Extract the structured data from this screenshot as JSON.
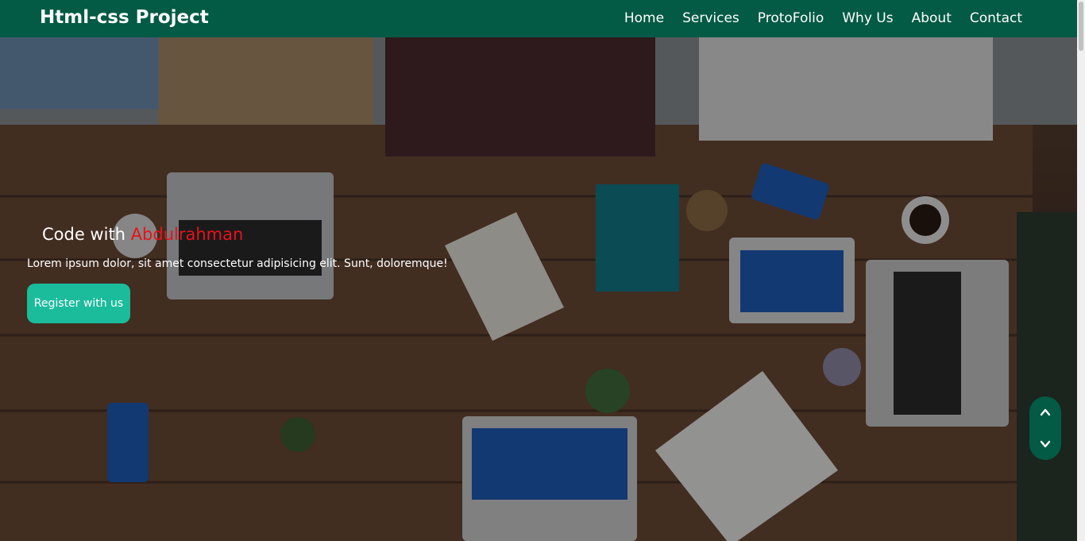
{
  "navbar": {
    "brand": "Html-css Project",
    "links": [
      "Home",
      "Services",
      "ProtoFolio",
      "Why Us",
      "About",
      "Contact"
    ]
  },
  "hero": {
    "title_prefix": "Code with ",
    "title_accent": "Abdulrahman",
    "description": "Lorem ipsum dolor, sit amet consectetur adipisicing elit. Sunt, doloremque!",
    "cta_label": "Register with us"
  },
  "icons": {
    "scroll_up": "chevron-up-icon",
    "scroll_down": "chevron-down-icon"
  },
  "colors": {
    "nav_bg": "#035a45",
    "accent": "#e8121b",
    "cta_bg": "#1abc9c",
    "scroll_widget_bg": "#035a45"
  }
}
